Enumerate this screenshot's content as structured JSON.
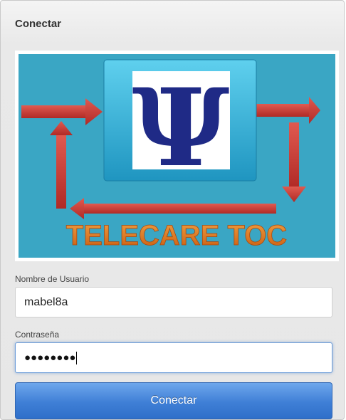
{
  "panel": {
    "title": "Conectar"
  },
  "logo": {
    "text": "TELECARE TOC",
    "symbol": "Ψ",
    "colors": {
      "background": "#3aa6c4",
      "arrow": "#c93a36",
      "box": "#35b3d9",
      "symbol": "#1f2a86",
      "text": "#e2731f"
    }
  },
  "form": {
    "username_label": "Nombre de Usuario",
    "username_value": "mabel8a",
    "password_label": "Contraseña",
    "password_masked": "●●●●●●●●",
    "submit_label": "Conectar"
  }
}
